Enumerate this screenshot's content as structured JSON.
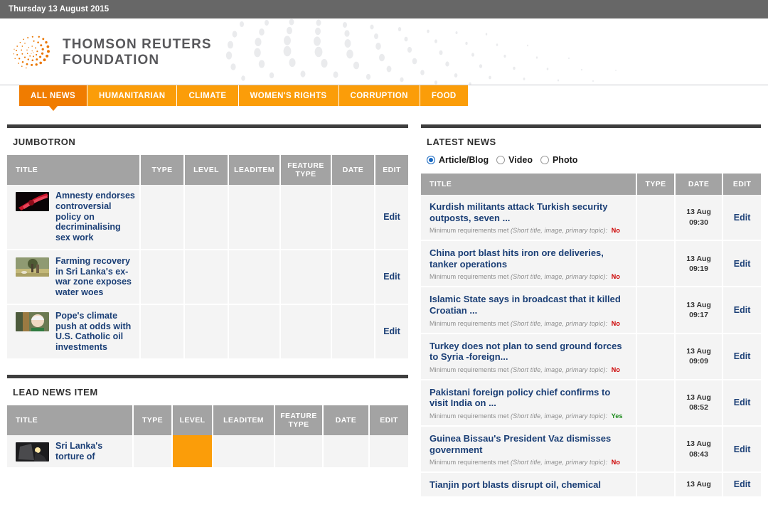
{
  "topbar": {
    "date": "Thursday 13 August 2015"
  },
  "masthead": {
    "logo_icon": "thomson-reuters-spiral-logo",
    "brand_line1": "THOMSON REUTERS",
    "brand_line2": "FOUNDATION"
  },
  "nav": {
    "tabs": [
      {
        "label": "ALL NEWS",
        "active": true
      },
      {
        "label": "HUMANITARIAN",
        "active": false
      },
      {
        "label": "CLIMATE",
        "active": false
      },
      {
        "label": "WOMEN'S RIGHTS",
        "active": false
      },
      {
        "label": "CORRUPTION",
        "active": false
      },
      {
        "label": "FOOD",
        "active": false
      }
    ]
  },
  "colors": {
    "accent_orange": "#fb9d09",
    "active_tab_orange": "#f07c00",
    "link_blue": "#1b3f76",
    "header_grey": "#a3a3a3",
    "rule_dark": "#3e3e3e",
    "req_no_red": "#cc0000",
    "req_yes_green": "#1a8a1a",
    "topbar_grey": "#676767"
  },
  "jumbotron": {
    "title": "JUMBOTRON",
    "columns": [
      "TITLE",
      "TYPE",
      "LEVEL",
      "LEADITEM",
      "FEATURE TYPE",
      "DATE",
      "EDIT"
    ],
    "rows": [
      {
        "title": "Amnesty endorses controversial policy on decriminalising sex work",
        "thumb": "red-abstract-thumbnail",
        "type": "",
        "level": "",
        "leaditem": "",
        "feature_type": "",
        "date": "",
        "edit": "Edit"
      },
      {
        "title": "Farming recovery in Sri Lanka's ex-war zone exposes water woes",
        "thumb": "field-tree-thumbnail",
        "type": "",
        "level": "",
        "leaditem": "",
        "feature_type": "",
        "date": "",
        "edit": "Edit"
      },
      {
        "title": "Pope's climate push at odds with U.S. Catholic oil investments",
        "thumb": "pope-portrait-thumbnail",
        "type": "",
        "level": "",
        "leaditem": "",
        "feature_type": "",
        "date": "",
        "edit": "Edit"
      }
    ]
  },
  "lead_news_item": {
    "title": "LEAD NEWS ITEM",
    "columns": [
      "TITLE",
      "TYPE",
      "LEVEL",
      "LEADITEM",
      "FEATURE TYPE",
      "DATE",
      "EDIT"
    ],
    "rows": [
      {
        "title": "Sri Lanka's torture of",
        "thumb": "dark-interrogation-thumbnail",
        "type": "",
        "level_highlighted": true,
        "leaditem": "",
        "feature_type": "",
        "date": "",
        "edit": ""
      }
    ]
  },
  "latest_news": {
    "title": "LATEST NEWS",
    "filters": [
      {
        "label": "Article/Blog",
        "selected": true
      },
      {
        "label": "Video",
        "selected": false
      },
      {
        "label": "Photo",
        "selected": false
      }
    ],
    "columns": [
      "TITLE",
      "TYPE",
      "DATE",
      "EDIT"
    ],
    "requirement_prefix": "Minimum requirements met",
    "requirement_detail": "(Short title, image, primary topic):",
    "rows": [
      {
        "headline": "Kurdish militants attack Turkish security outposts, seven ...",
        "requirements_met": "No",
        "type": "",
        "date_day": "13 Aug",
        "date_time": "09:30",
        "edit": "Edit"
      },
      {
        "headline": "China port blast hits iron ore deliveries, tanker operations",
        "requirements_met": "No",
        "type": "",
        "date_day": "13 Aug",
        "date_time": "09:19",
        "edit": "Edit"
      },
      {
        "headline": "Islamic State says in broadcast that it killed Croatian ...",
        "requirements_met": "No",
        "type": "",
        "date_day": "13 Aug",
        "date_time": "09:17",
        "edit": "Edit"
      },
      {
        "headline": "Turkey does not plan to send ground forces to Syria -foreign...",
        "requirements_met": "No",
        "type": "",
        "date_day": "13 Aug",
        "date_time": "09:09",
        "edit": "Edit"
      },
      {
        "headline": "Pakistani foreign policy chief confirms to visit India on ...",
        "requirements_met": "Yes",
        "type": "",
        "date_day": "13 Aug",
        "date_time": "08:52",
        "edit": "Edit"
      },
      {
        "headline": "Guinea Bissau's President Vaz dismisses government",
        "requirements_met": "No",
        "type": "",
        "date_day": "13 Aug",
        "date_time": "08:43",
        "edit": "Edit"
      },
      {
        "headline": "Tianjin port blasts disrupt oil, chemical",
        "requirements_met": "",
        "type": "",
        "date_day": "13 Aug",
        "date_time": "",
        "edit": "Edit"
      }
    ]
  }
}
